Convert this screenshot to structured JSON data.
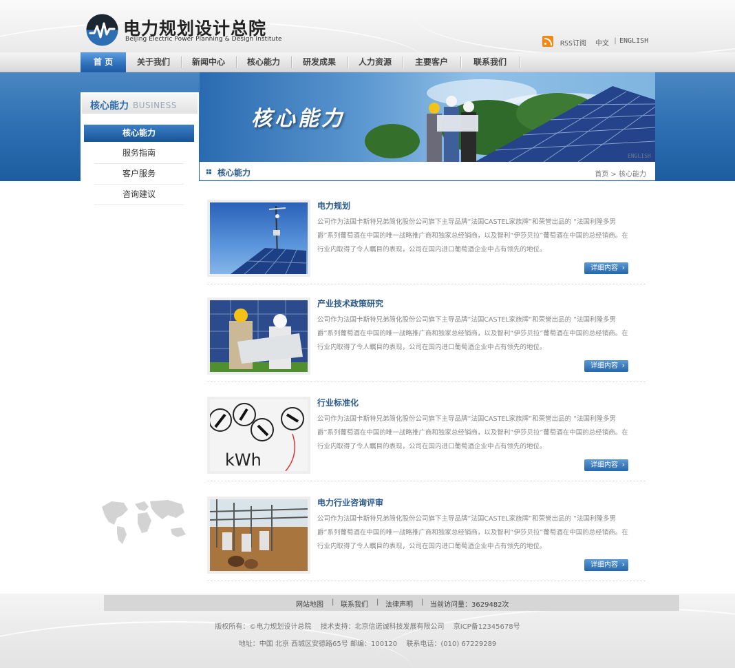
{
  "header": {
    "logo_title": "电力规划设计总院",
    "logo_subtitle": "Beijing Electric Power Planning & Design Institute",
    "rss_label": "RSS订阅",
    "lang_cn": "中文",
    "lang_sep": "|",
    "lang_en": "ENGLISH"
  },
  "nav": {
    "items": [
      {
        "label": "首 页",
        "active": true
      },
      {
        "label": "关于我们"
      },
      {
        "label": "新闻中心"
      },
      {
        "label": "核心能力"
      },
      {
        "label": "研发成果"
      },
      {
        "label": "人力资源"
      },
      {
        "label": "主要客户"
      },
      {
        "label": "联系我们"
      }
    ]
  },
  "banner": {
    "title": "核心能力",
    "en_text": "ENGLISH"
  },
  "sidebar": {
    "title_cn": "核心能力",
    "title_en": "BUSINESS",
    "items": [
      {
        "label": "核心能力",
        "active": true
      },
      {
        "label": "服务指南"
      },
      {
        "label": "客户服务"
      },
      {
        "label": "咨询建议"
      }
    ]
  },
  "content": {
    "section_title": "核心能力",
    "breadcrumb": "首页 > 核心能力",
    "items": [
      {
        "title": "电力规划",
        "text": "公司作为法国卡斯特兄弟简化股份公司旗下主导品牌“法国CASTEL家族牌”和荣誉出品的 “法国利隆多男爵”系列葡萄酒在中国的唯一战略推广商和独家总经销商，以及智利“伊莎贝拉”葡萄酒在中国的总经销商。在行业内取得了令人瞩目的表现，公司在国内进口葡萄酒企业中占有领先的地位。",
        "more": "详细内容"
      },
      {
        "title": "产业技术政策研究",
        "text": "公司作为法国卡斯特兄弟简化股份公司旗下主导品牌“法国CASTEL家族牌”和荣誉出品的 “法国利隆多男爵”系列葡萄酒在中国的唯一战略推广商和独家总经销商，以及智利“伊莎贝拉”葡萄酒在中国的总经销商。在行业内取得了令人瞩目的表现，公司在国内进口葡萄酒企业中占有领先的地位。",
        "more": "详细内容"
      },
      {
        "title": "行业标准化",
        "text": "公司作为法国卡斯特兄弟简化股份公司旗下主导品牌“法国CASTEL家族牌”和荣誉出品的 “法国利隆多男爵”系列葡萄酒在中国的唯一战略推广商和独家总经销商，以及智利“伊莎贝拉”葡萄酒在中国的总经销商。在行业内取得了令人瞩目的表现，公司在国内进口葡萄酒企业中占有领先的地位。",
        "more": "详细内容",
        "meter_text": "kWh"
      },
      {
        "title": "电力行业咨询评审",
        "text": "公司作为法国卡斯特兄弟简化股份公司旗下主导品牌“法国CASTEL家族牌”和荣誉出品的 “法国利隆多男爵”系列葡萄酒在中国的唯一战略推广商和独家总经销商，以及智利“伊莎贝拉”葡萄酒在中国的总经销商。在行业内取得了令人瞩目的表现，公司在国内进口葡萄酒企业中占有领先的地位。",
        "more": "详细内容"
      }
    ]
  },
  "footer": {
    "links": [
      "网站地图",
      "联系我们",
      "法律声明"
    ],
    "visits": "当前访问量：3629482次",
    "sep": "|",
    "copyright": "版权所有：©电力规划设计总院",
    "support": "技术支持：北京信诺诚科技发展有限公司",
    "icp": "京ICP备12345678号",
    "address": "地址：中国 北京 西城区安德路65号 邮编：100120",
    "phone": "联系电话：(010) 67229289"
  },
  "colors": {
    "accent": "#2b6aac",
    "banner": "#2a6db0",
    "rss": "#f08a16"
  }
}
